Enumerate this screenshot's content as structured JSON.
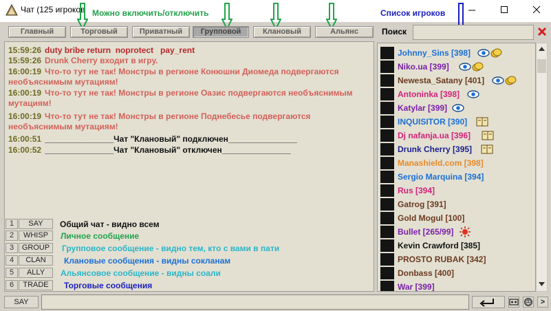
{
  "window": {
    "title": "Чат (125 игроков",
    "controls": [
      "minimize-icon",
      "maximize-icon",
      "close-icon"
    ]
  },
  "annotations": {
    "toggle_note": "Можно включить/отключить",
    "players_note": "Список игроков"
  },
  "tabs": [
    {
      "label": "Главный",
      "active": false
    },
    {
      "label": "Торговый",
      "active": false
    },
    {
      "label": "Приватный",
      "active": false
    },
    {
      "label": "Групповой",
      "active": true
    },
    {
      "label": "Клановый",
      "active": false
    },
    {
      "label": "Альянс",
      "active": false
    }
  ],
  "messages": [
    {
      "time": "15:59:26",
      "text": "duty bribe return  noprotect   pay_rent",
      "color": "#b8282a"
    },
    {
      "time": "15:59:26",
      "text": "Drunk Cherry входит в игру.",
      "color": "#d36158"
    },
    {
      "time": "16:00:19",
      "text": "Что-то тут не так! Монстры в регионе Конюшни Диомеда подвергаются необъяснимым мутациям!",
      "color": "#d36158"
    },
    {
      "time": "16:00:19",
      "text": "Что-то тут не так! Монстры в регионе Оазис подвергаются необъяснимым мутациям!",
      "color": "#d36158"
    },
    {
      "time": "16:00:19",
      "text": "Что-то тут не так! Монстры в регионе Поднебесье подвергаются необъяснимым мутациям!",
      "color": "#d36158"
    },
    {
      "time": "16:00:51",
      "text": "_______________Чат \"Клановый\" подключен_______________",
      "color": "#111111"
    },
    {
      "time": "16:00:52",
      "text": "_______________Чат \"Клановый\" отключен_______________",
      "color": "#111111"
    }
  ],
  "channels": [
    {
      "num": "1",
      "button": "SAY",
      "desc": "Общий чат - видно всем",
      "color": "#111111"
    },
    {
      "num": "2",
      "button": "WHISP",
      "desc": "Личное сообщение",
      "color": "#22a34c"
    },
    {
      "num": "3",
      "button": "GROUP",
      "desc": "Групповое сообщение - видно тем, кто с вами в пати",
      "color": "#2bb5c8"
    },
    {
      "num": "4",
      "button": "CLAN",
      "desc": "Клановые сообщения - видны сокланам",
      "color": "#1c6fd6"
    },
    {
      "num": "5",
      "button": "ALLY",
      "desc": "Альянсовое сообщение - видны соали",
      "color": "#2bb5c8"
    },
    {
      "num": "6",
      "button": "TRADE",
      "desc": "Торговые сообщения",
      "color": "#1a1fbf"
    }
  ],
  "input": {
    "say_label": "SAY",
    "value": "",
    "side_buttons": [
      "cassette-icon",
      "smiley-icon",
      ">"
    ]
  },
  "search": {
    "label": "Поиск",
    "value": ""
  },
  "players": [
    {
      "name": "Johnny_Sins [398]",
      "color": "#1c6fd6",
      "badges": [
        "eye-icon",
        "coins-icon"
      ]
    },
    {
      "name": "Niko.ua [399]",
      "color": "#7a1fa8",
      "badges": [
        "eye-icon",
        "coins-icon"
      ]
    },
    {
      "name": "Newesta_Satany [401]",
      "color": "#6b3a1e",
      "badges": [
        "eye-icon",
        "coins-icon"
      ]
    },
    {
      "name": "Antoninka [398]",
      "color": "#d4227a",
      "badges": [
        "eye-icon"
      ]
    },
    {
      "name": "Katylar [399]",
      "color": "#7a1fa8",
      "badges": [
        "eye-icon"
      ]
    },
    {
      "name": "INQUISITOR [390]",
      "color": "#1c6fd6",
      "badges": [
        "book-icon"
      ]
    },
    {
      "name": "Dj nafanja.ua [396]",
      "color": "#d4227a",
      "badges": [
        "book-icon"
      ]
    },
    {
      "name": "Drunk Cherry [395]",
      "color": "#1a1f8f",
      "badges": [
        "book-icon"
      ]
    },
    {
      "name": "Manashield.com [398]",
      "color": "#e88a2a",
      "badges": []
    },
    {
      "name": "Sergio Marquina [394]",
      "color": "#1c6fd6",
      "badges": []
    },
    {
      "name": "Rus [394]",
      "color": "#d4227a",
      "badges": []
    },
    {
      "name": "Gatrog [391]",
      "color": "#6b3a1e",
      "badges": []
    },
    {
      "name": "Gold Mogul [100]",
      "color": "#6b3a1e",
      "badges": []
    },
    {
      "name": "Bullet [265/99]",
      "color": "#7a1fa8",
      "badges": [
        "sun-icon"
      ]
    },
    {
      "name": "Kevin Crawford [385]",
      "color": "#111111",
      "badges": []
    },
    {
      "name": "PROSTO RUBAK [342]",
      "color": "#6b3a1e",
      "badges": []
    },
    {
      "name": "Donbass [400]",
      "color": "#6b3a1e",
      "badges": []
    },
    {
      "name": "War [399]",
      "color": "#7a1fa8",
      "badges": []
    }
  ]
}
